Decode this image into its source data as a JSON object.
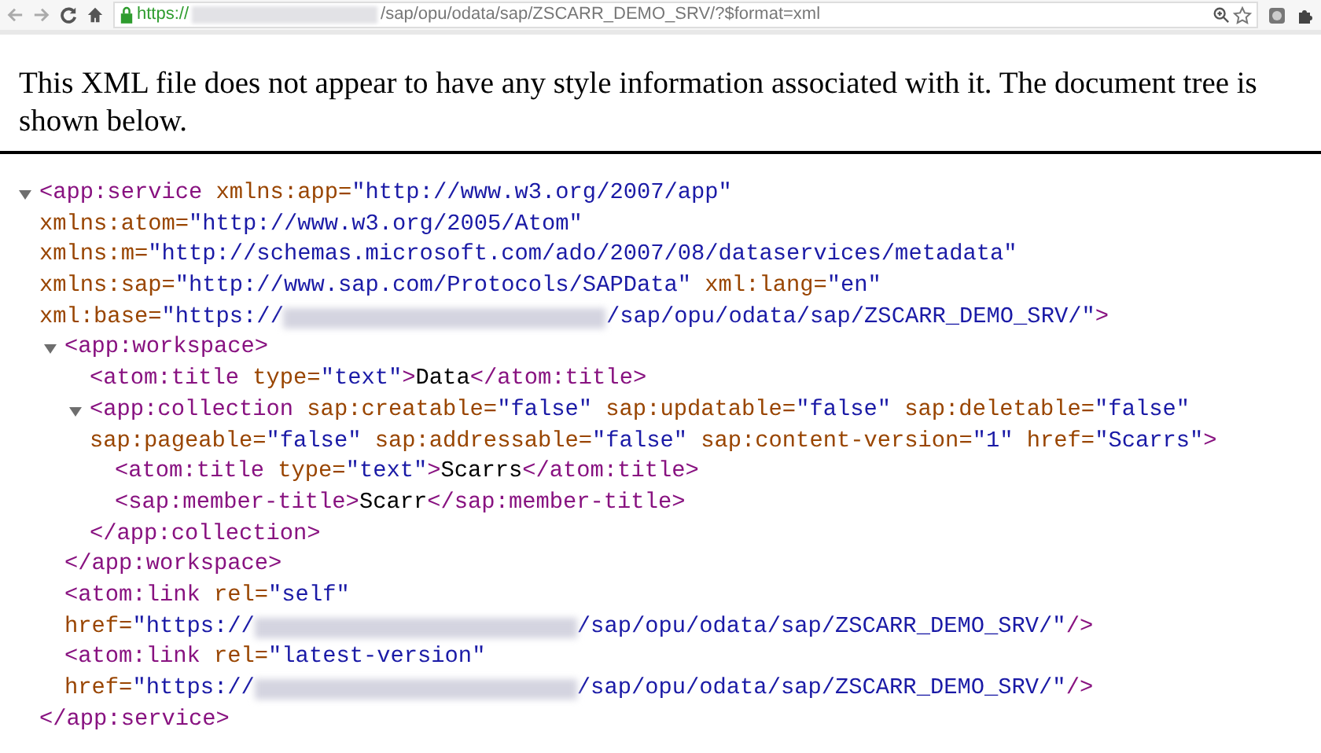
{
  "browser": {
    "url": [
      {
        "kind": "secure",
        "text": "https://"
      },
      {
        "kind": "redacted"
      },
      {
        "kind": "path",
        "text": "/sap/opu/odata/sap/ZSCARR_DEMO_SRV/?$format=xml"
      }
    ]
  },
  "notice": "This XML file does not appear to have any style information associated with it. The document tree is shown below.",
  "tree": {
    "kind": "branch",
    "expanded": true,
    "lines": [
      [
        {
          "kind": "tag",
          "text": "<app:service"
        },
        {
          "kind": "attr",
          "text": "xmlns:app="
        },
        {
          "kind": "value",
          "text": "\"http://www.w3.org/2007/app\""
        }
      ],
      [
        {
          "kind": "attr",
          "text": "xmlns:atom="
        },
        {
          "kind": "value",
          "text": "\"http://www.w3.org/2005/Atom\""
        }
      ],
      [
        {
          "kind": "attr",
          "text": "xmlns:m="
        },
        {
          "kind": "value",
          "text": "\"http://schemas.microsoft.com/ado/2007/08/dataservices/metadata\""
        }
      ],
      [
        {
          "kind": "attr",
          "text": "xmlns:sap="
        },
        {
          "kind": "value",
          "text": "\"http://www.sap.com/Protocols/SAPData\""
        },
        {
          "kind": "attr",
          "text": "xml:lang="
        },
        {
          "kind": "value",
          "text": "\"en\""
        }
      ],
      [
        {
          "kind": "attr",
          "text": "xml:base="
        },
        {
          "kind": "value",
          "text": "\"https://"
        },
        {
          "kind": "redacted"
        },
        {
          "kind": "value",
          "text": "/sap/opu/odata/sap/ZSCARR_DEMO_SRV/\""
        },
        {
          "kind": "tag",
          "text": ">"
        }
      ]
    ],
    "children": [
      {
        "kind": "branch",
        "expanded": true,
        "lines": [
          [
            {
              "kind": "tag",
              "text": "<app:workspace>"
            }
          ]
        ],
        "children": [
          {
            "kind": "leaf",
            "lines": [
              [
                {
                  "kind": "tag",
                  "text": "<atom:title"
                },
                {
                  "kind": "attr",
                  "text": "type="
                },
                {
                  "kind": "value",
                  "text": "\"text\""
                },
                {
                  "kind": "tag",
                  "text": ">"
                },
                {
                  "kind": "text",
                  "text": "Data"
                },
                {
                  "kind": "tag",
                  "text": "</atom:title>"
                }
              ]
            ]
          },
          {
            "kind": "branch",
            "expanded": true,
            "lines": [
              [
                {
                  "kind": "tag",
                  "text": "<app:collection"
                },
                {
                  "kind": "attr",
                  "text": "sap:creatable="
                },
                {
                  "kind": "value",
                  "text": "\"false\""
                },
                {
                  "kind": "attr",
                  "text": "sap:updatable="
                },
                {
                  "kind": "value",
                  "text": "\"false\""
                },
                {
                  "kind": "attr",
                  "text": "sap:deletable="
                },
                {
                  "kind": "value",
                  "text": "\"false\""
                }
              ],
              [
                {
                  "kind": "attr",
                  "text": "sap:pageable="
                },
                {
                  "kind": "value",
                  "text": "\"false\""
                },
                {
                  "kind": "attr",
                  "text": "sap:addressable="
                },
                {
                  "kind": "value",
                  "text": "\"false\""
                },
                {
                  "kind": "attr",
                  "text": "sap:content-version="
                },
                {
                  "kind": "value",
                  "text": "\"1\""
                },
                {
                  "kind": "attr",
                  "text": "href="
                },
                {
                  "kind": "value",
                  "text": "\"Scarrs\""
                },
                {
                  "kind": "tag",
                  "text": ">"
                }
              ]
            ],
            "children": [
              {
                "kind": "leaf",
                "lines": [
                  [
                    {
                      "kind": "tag",
                      "text": "<atom:title"
                    },
                    {
                      "kind": "attr",
                      "text": "type="
                    },
                    {
                      "kind": "value",
                      "text": "\"text\""
                    },
                    {
                      "kind": "tag",
                      "text": ">"
                    },
                    {
                      "kind": "text",
                      "text": "Scarrs"
                    },
                    {
                      "kind": "tag",
                      "text": "</atom:title>"
                    }
                  ]
                ]
              },
              {
                "kind": "leaf",
                "lines": [
                  [
                    {
                      "kind": "tag",
                      "text": "<sap:member-title>"
                    },
                    {
                      "kind": "text",
                      "text": "Scarr"
                    },
                    {
                      "kind": "tag",
                      "text": "</sap:member-title>"
                    }
                  ]
                ]
              }
            ],
            "closing": [
              {
                "kind": "tag",
                "text": "</app:collection>"
              }
            ]
          }
        ],
        "closing": [
          {
            "kind": "tag",
            "text": "</app:workspace>"
          }
        ]
      },
      {
        "kind": "leaf",
        "lines": [
          [
            {
              "kind": "tag",
              "text": "<atom:link"
            },
            {
              "kind": "attr",
              "text": "rel="
            },
            {
              "kind": "value",
              "text": "\"self\""
            }
          ],
          [
            {
              "kind": "attr",
              "text": "href="
            },
            {
              "kind": "value",
              "text": "\"https://"
            },
            {
              "kind": "redacted"
            },
            {
              "kind": "value",
              "text": "/sap/opu/odata/sap/ZSCARR_DEMO_SRV/\""
            },
            {
              "kind": "tag",
              "text": "/>"
            }
          ]
        ]
      },
      {
        "kind": "leaf",
        "lines": [
          [
            {
              "kind": "tag",
              "text": "<atom:link"
            },
            {
              "kind": "attr",
              "text": "rel="
            },
            {
              "kind": "value",
              "text": "\"latest-version\""
            }
          ],
          [
            {
              "kind": "attr",
              "text": "href="
            },
            {
              "kind": "value",
              "text": "\"https://"
            },
            {
              "kind": "redacted"
            },
            {
              "kind": "value",
              "text": "/sap/opu/odata/sap/ZSCARR_DEMO_SRV/\""
            },
            {
              "kind": "tag",
              "text": "/>"
            }
          ]
        ]
      }
    ],
    "closing": [
      {
        "kind": "tag",
        "text": "</app:service>"
      }
    ]
  }
}
